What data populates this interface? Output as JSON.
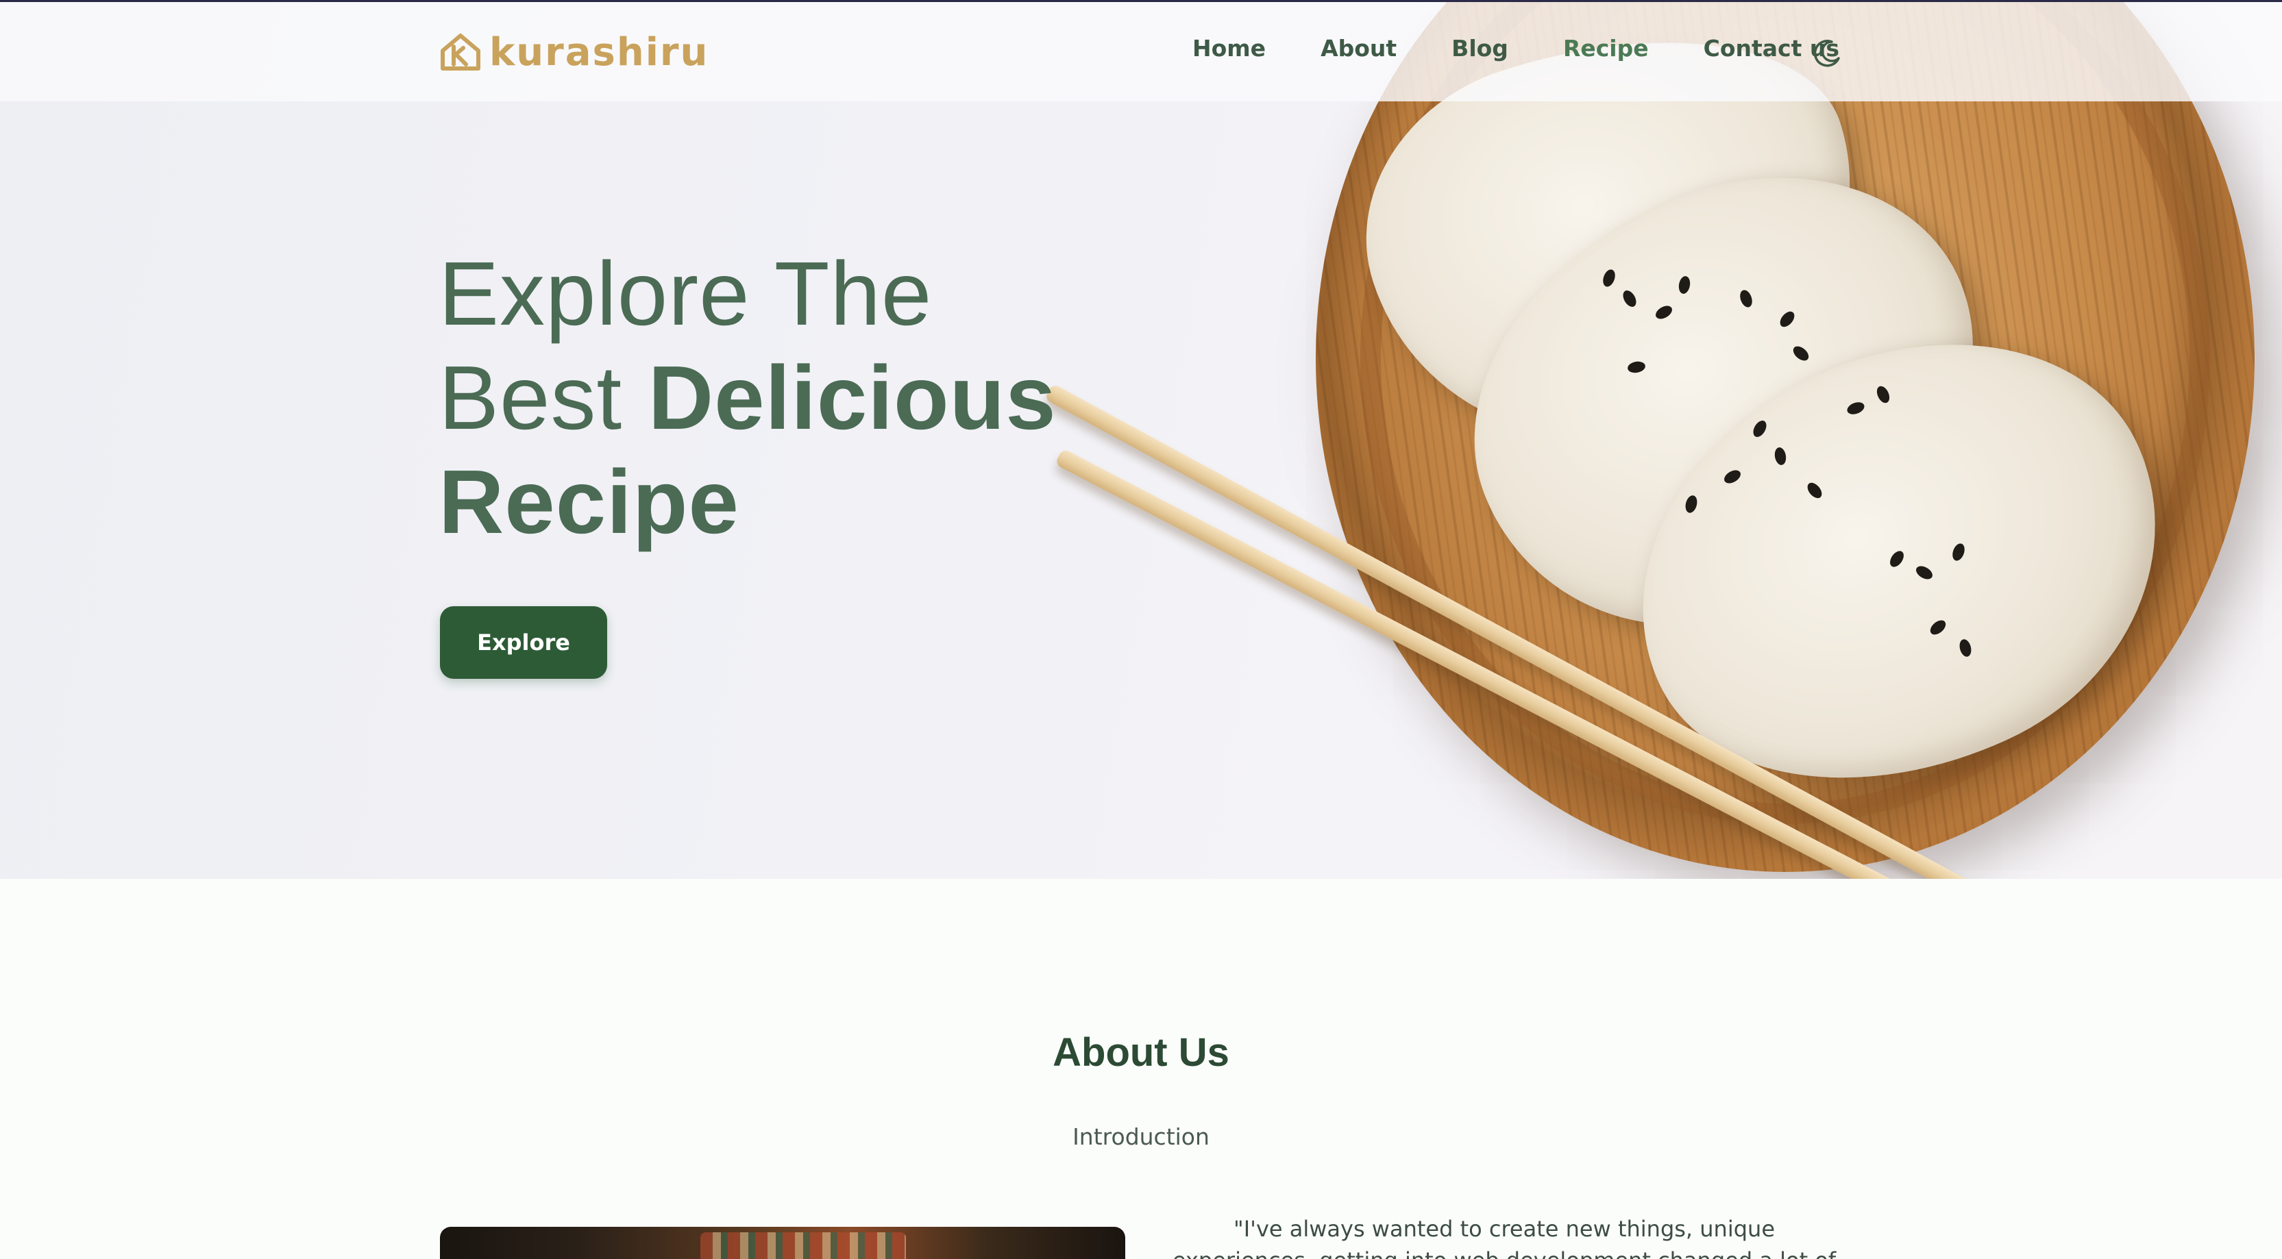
{
  "nav": {
    "logo_text": "kurashiru",
    "links": [
      "Home",
      "About",
      "Blog",
      "Recipe",
      "Contact us"
    ],
    "active": "Recipe"
  },
  "hero": {
    "title_line1": "Explore The",
    "title_line2_light": "Best ",
    "title_line2_bold": "Delicious",
    "title_line3": "Recipe",
    "button_label": "Explore"
  },
  "about": {
    "title": "About Us",
    "subtitle": "Introduction",
    "quote": "\"I've always wanted to create new things, unique experiences, getting into web development changed a lot of things for me, and"
  },
  "colors": {
    "primary": "#2d5b36",
    "heading": "#4b6b54",
    "logo": "#c9a25c"
  }
}
